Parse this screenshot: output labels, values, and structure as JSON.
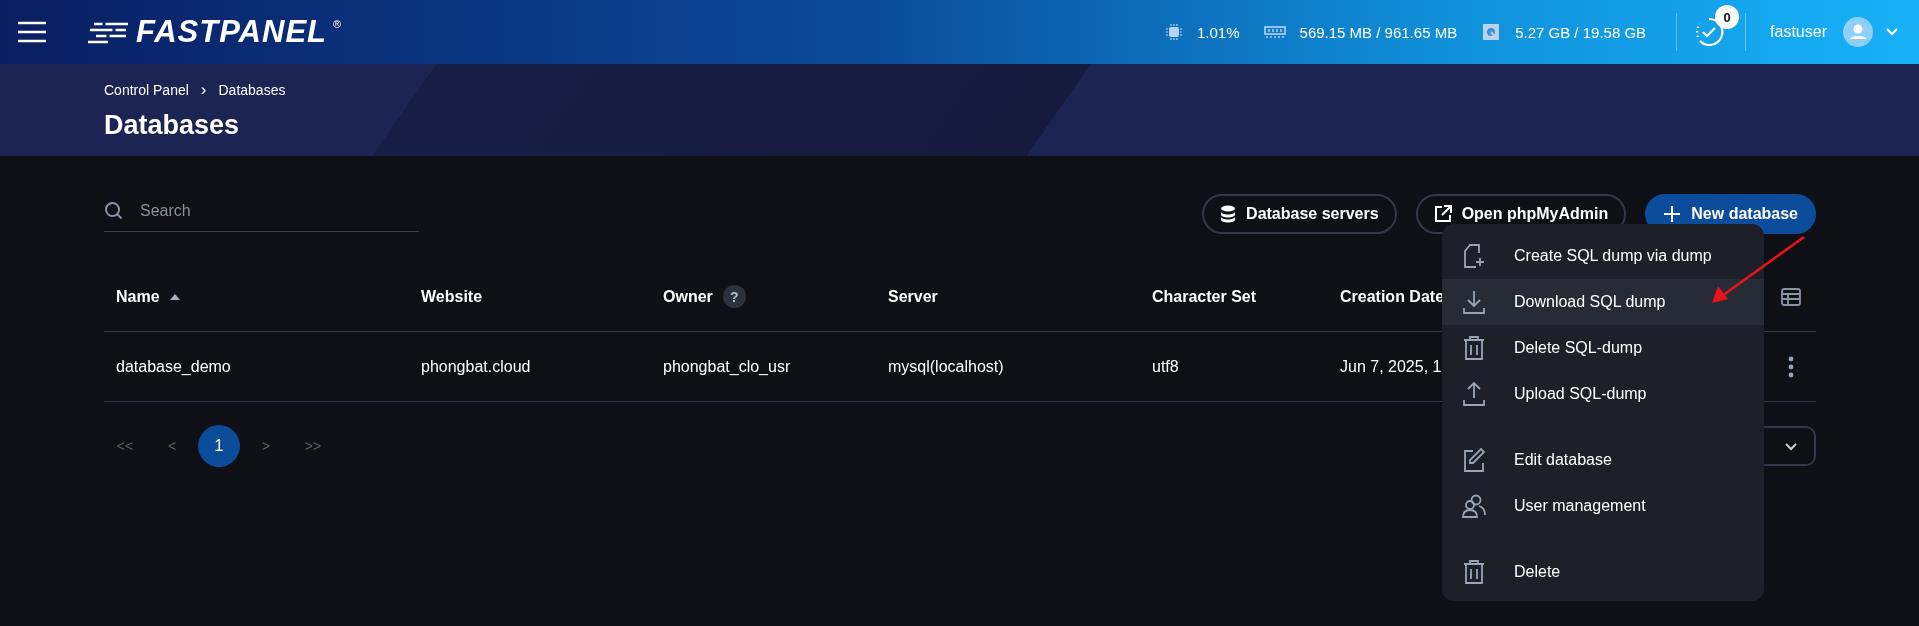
{
  "header": {
    "logo": "FASTPANEL",
    "registered": "®",
    "stats": [
      {
        "kind": "cpu",
        "text": "1.01%"
      },
      {
        "kind": "ram",
        "text": "569.15 MB / 961.65 MB"
      },
      {
        "kind": "disk",
        "text": "5.27 GB / 19.58 GB"
      }
    ],
    "tasks_badge": "0",
    "user": "fastuser"
  },
  "banner": {
    "breadcrumbs": [
      "Control Panel",
      "Databases"
    ],
    "separator": "›",
    "title": "Databases"
  },
  "toolbar": {
    "search": {
      "placeholder": "Search"
    },
    "buttons": [
      {
        "kind": "servers",
        "label": "Database servers"
      },
      {
        "kind": "external",
        "label": "Open phpMyAdmin"
      },
      {
        "kind": "new",
        "label": "New database"
      }
    ]
  },
  "table": {
    "columns": [
      {
        "label": "Name",
        "sorted": true
      },
      {
        "label": "Website",
        "sorted": false
      },
      {
        "label": "Owner",
        "help": "?",
        "sorted": false
      },
      {
        "label": "Server",
        "sorted": false
      },
      {
        "label": "Character Set",
        "sorted": false
      },
      {
        "label": "Creation Date",
        "sorted": false
      }
    ],
    "rows": [
      {
        "cells": [
          "database_demo",
          "phongbat.cloud",
          "phongbat_clo_usr",
          "mysql(localhost)",
          "utf8",
          "Jun 7, 2025, 1"
        ]
      }
    ]
  },
  "pagination": [
    {
      "label": "<<",
      "selected": false
    },
    {
      "label": "<",
      "selected": false
    },
    {
      "label": "1",
      "selected": true
    },
    {
      "label": ">",
      "selected": false
    },
    {
      "label": ">>",
      "selected": false
    }
  ],
  "context_menu": {
    "groups": [
      [
        {
          "kind": "create",
          "label": "Create SQL dump via dump",
          "selected": false
        },
        {
          "kind": "download",
          "label": "Download SQL dump",
          "selected": true
        },
        {
          "kind": "trash",
          "label": "Delete SQL-dump",
          "selected": false
        },
        {
          "kind": "upload",
          "label": "Upload SQL-dump",
          "selected": false
        }
      ],
      [
        {
          "kind": "edit",
          "label": "Edit database",
          "selected": false
        },
        {
          "kind": "users",
          "label": "User management",
          "selected": false
        }
      ],
      [
        {
          "kind": "trash",
          "label": "Delete",
          "selected": false
        }
      ]
    ]
  }
}
